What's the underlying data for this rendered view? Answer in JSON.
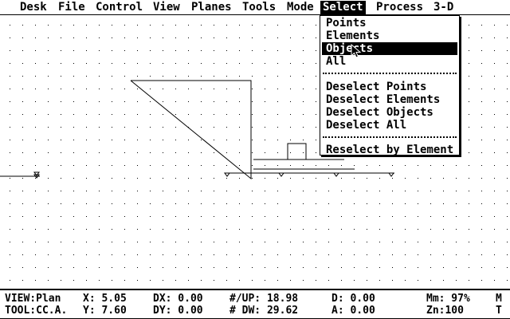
{
  "menubar": {
    "items": [
      "Desk",
      "File",
      "Control",
      "View",
      "Planes",
      "Tools",
      "Mode",
      "Select",
      "Process",
      "3-D"
    ],
    "active": "Select"
  },
  "select_menu": {
    "group1": [
      "Points",
      "Elements",
      "Objects",
      "All"
    ],
    "group2": [
      "Deselect Points",
      "Deselect Elements",
      "Deselect Objects",
      "Deselect All"
    ],
    "group3": [
      "Reselect by Element"
    ],
    "highlighted": "Objects"
  },
  "status": {
    "view": "VIEW:Plan",
    "tool": "TOOL:CC.A.",
    "x": "X: 5.05",
    "y": "Y: 7.60",
    "dx": "DX: 0.00",
    "dy": "DY: 0.00",
    "up": "#/UP: 18.98",
    "dw": "# DW: 29.62",
    "d": "D: 0.00",
    "a": "A: 0.00",
    "mm": "Mm: 97%",
    "zm": "Zn:100",
    "m": "M",
    "t": "T"
  },
  "colors": {
    "fg": "#000000",
    "bg": "#ffffff"
  }
}
